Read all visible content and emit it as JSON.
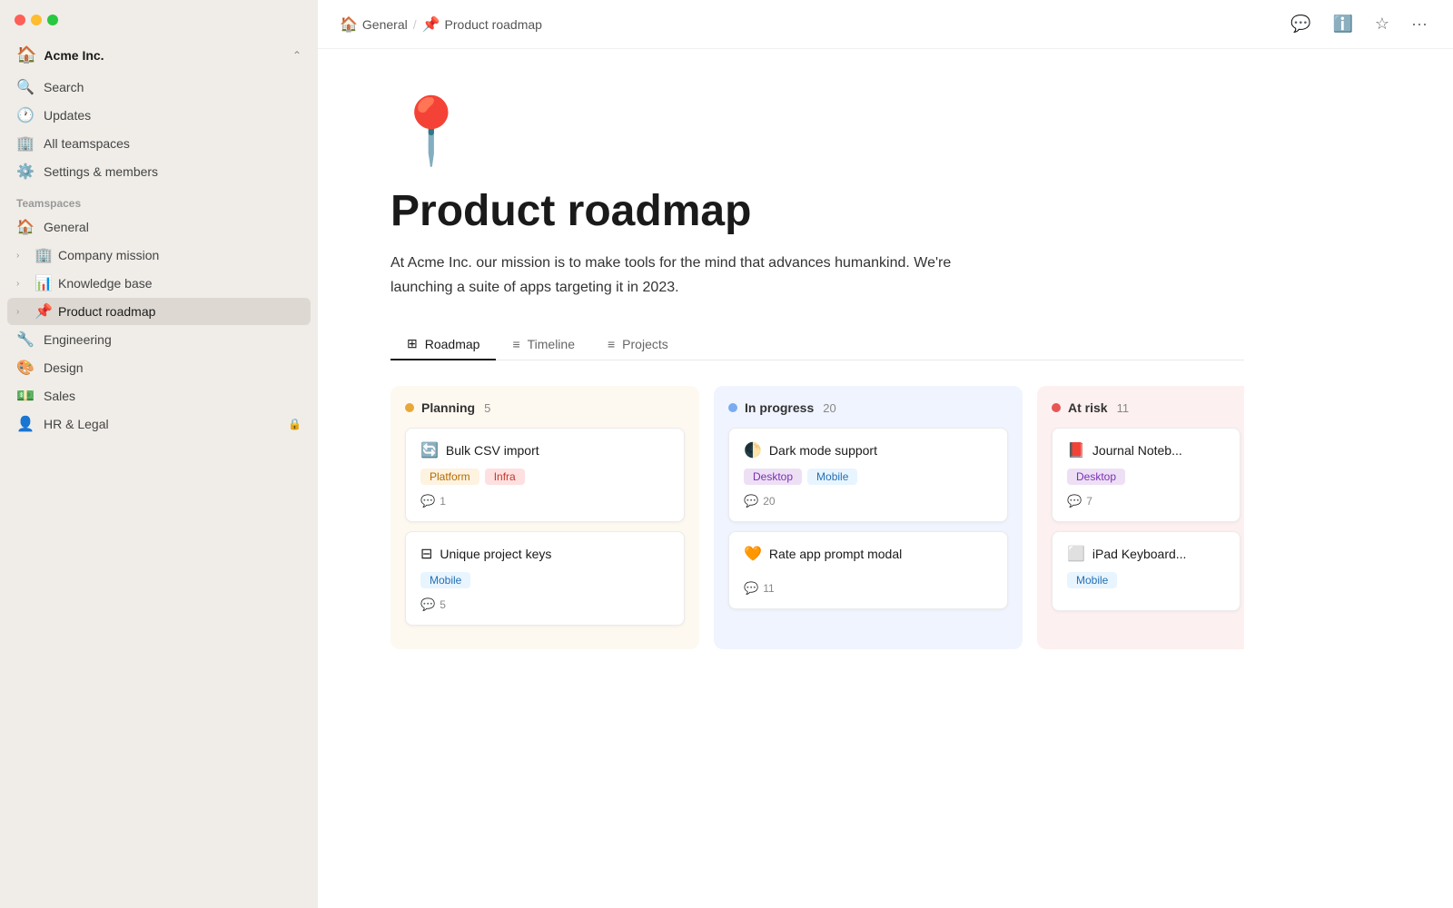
{
  "window": {
    "traffic_lights": [
      "red",
      "yellow",
      "green"
    ]
  },
  "sidebar": {
    "workspace": {
      "icon": "🏠",
      "name": "Acme Inc.",
      "chevron": "⌃"
    },
    "nav_items": [
      {
        "id": "search",
        "icon": "🔍",
        "label": "Search"
      },
      {
        "id": "updates",
        "icon": "🕐",
        "label": "Updates"
      },
      {
        "id": "all-teamspaces",
        "icon": "🏢",
        "label": "All teamspaces"
      },
      {
        "id": "settings",
        "icon": "⚙️",
        "label": "Settings & members"
      }
    ],
    "teamspaces_label": "Teamspaces",
    "teamspace_items": [
      {
        "id": "general",
        "icon": "🏠",
        "label": "General",
        "hasChevron": false,
        "active": false
      },
      {
        "id": "company-mission",
        "icon": "🏢",
        "label": "Company mission",
        "hasChevron": true,
        "active": false
      },
      {
        "id": "knowledge-base",
        "icon": "📊",
        "label": "Knowledge base",
        "hasChevron": true,
        "active": false
      },
      {
        "id": "product-roadmap",
        "icon": "📌",
        "label": "Product roadmap",
        "hasChevron": true,
        "active": true
      },
      {
        "id": "engineering",
        "icon": "🔧",
        "label": "Engineering",
        "hasChevron": false,
        "active": false
      },
      {
        "id": "design",
        "icon": "🎨",
        "label": "Design",
        "hasChevron": false,
        "active": false
      },
      {
        "id": "sales",
        "icon": "💵",
        "label": "Sales",
        "hasChevron": false,
        "active": false
      },
      {
        "id": "hr-legal",
        "icon": "👤",
        "label": "HR & Legal",
        "hasChevron": false,
        "active": false,
        "locked": true
      }
    ]
  },
  "topbar": {
    "breadcrumb": [
      {
        "id": "general",
        "icon": "🏠",
        "label": "General"
      },
      {
        "separator": "/"
      },
      {
        "id": "product-roadmap",
        "icon": "📌",
        "label": "Product roadmap"
      }
    ],
    "actions": [
      "💬",
      "ℹ️",
      "☆",
      "···"
    ]
  },
  "page": {
    "emoji": "📍",
    "title": "Product roadmap",
    "description": "At Acme Inc. our mission is to make tools for the mind that advances humankind. We're launching a suite of apps targeting it in 2023.",
    "tabs": [
      {
        "id": "roadmap",
        "icon": "⊞",
        "label": "Roadmap",
        "active": true
      },
      {
        "id": "timeline",
        "icon": "≡",
        "label": "Timeline",
        "active": false
      },
      {
        "id": "projects",
        "icon": "≡",
        "label": "Projects",
        "active": false
      }
    ]
  },
  "kanban": {
    "columns": [
      {
        "id": "planning",
        "title": "Planning",
        "count": 5,
        "dot_class": "dot-planning",
        "col_class": "col-planning",
        "cards": [
          {
            "id": "bulk-csv",
            "icon": "🔄",
            "title": "Bulk CSV import",
            "tags": [
              {
                "label": "Platform",
                "class": "tag-platform"
              },
              {
                "label": "Infra",
                "class": "tag-infra"
              }
            ],
            "comments": 1
          },
          {
            "id": "unique-project-keys",
            "icon": "⊟",
            "title": "Unique project keys",
            "tags": [
              {
                "label": "Mobile",
                "class": "tag-mobile"
              }
            ],
            "comments": 5
          }
        ]
      },
      {
        "id": "inprogress",
        "title": "In progress",
        "count": 20,
        "dot_class": "dot-inprogress",
        "col_class": "col-inprogress",
        "cards": [
          {
            "id": "dark-mode",
            "icon": "🌓",
            "title": "Dark mode support",
            "tags": [
              {
                "label": "Desktop",
                "class": "tag-desktop"
              },
              {
                "label": "Mobile",
                "class": "tag-mobile"
              }
            ],
            "comments": 20
          },
          {
            "id": "rate-app",
            "icon": "🧡",
            "title": "Rate app prompt modal",
            "tags": [],
            "comments": 11
          }
        ]
      },
      {
        "id": "atrisk",
        "title": "At risk",
        "count": 11,
        "dot_class": "dot-atrisk",
        "col_class": "col-atrisk",
        "cards": [
          {
            "id": "journal-notebook",
            "icon": "📕",
            "title": "Journal Noteb...",
            "tags": [
              {
                "label": "Desktop",
                "class": "tag-desktop"
              }
            ],
            "comments": 7
          },
          {
            "id": "ipad-keyboard",
            "icon": "⬜",
            "title": "iPad Keyboard...",
            "tags": [
              {
                "label": "Mobile",
                "class": "tag-mobile"
              }
            ],
            "comments": null
          }
        ]
      }
    ]
  }
}
